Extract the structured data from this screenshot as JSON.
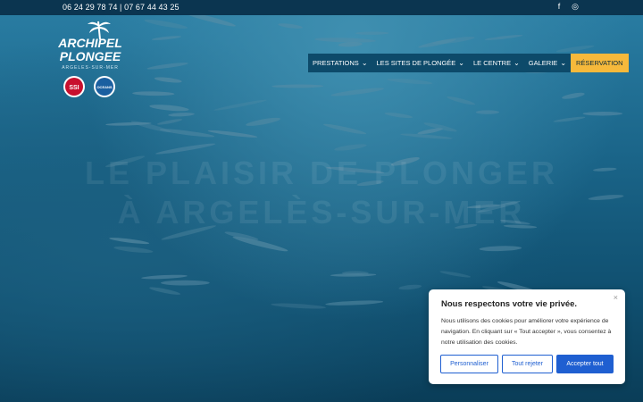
{
  "topbar": {
    "phone": "06 24 29 78 74 | 07 67 44 43 25",
    "social": [
      {
        "icon": "facebook-icon",
        "glyph": "f"
      },
      {
        "icon": "instagram-icon",
        "glyph": "◎"
      }
    ]
  },
  "logo": {
    "line1": "ARCHIPEL",
    "line2": "PLONGEE",
    "line3": "ARGELES-SUR-MER",
    "badge1": "SSI",
    "badge2": "OCEANS"
  },
  "nav": {
    "items": [
      {
        "label": "Prestations",
        "has_dropdown": true
      },
      {
        "label": "Les sites de plongée",
        "has_dropdown": true
      },
      {
        "label": "Le centre",
        "has_dropdown": true
      },
      {
        "label": "Galerie",
        "has_dropdown": true
      },
      {
        "label": "Réservation",
        "has_dropdown": false
      }
    ],
    "chevron": "⌄"
  },
  "hero": {
    "title_line1": "LE PLAISIR DE PLONGER",
    "title_line2": "À ARGELÈS-SUR-MER"
  },
  "cookie": {
    "close": "×",
    "title": "Nous respectons votre vie privée.",
    "text": "Nous utilisons des cookies pour améliorer votre expérience de navigation. En cliquant sur « Tout accepter », vous consentez à notre utilisation des cookies.",
    "customize": "Personnaliser",
    "reject": "Tout rejeter",
    "accept": "Accepter tout"
  },
  "colors": {
    "topbar": "#0b3550",
    "nav": "#0d4a6a",
    "cta": "#f6b93b",
    "button": "#1f5fd1"
  }
}
